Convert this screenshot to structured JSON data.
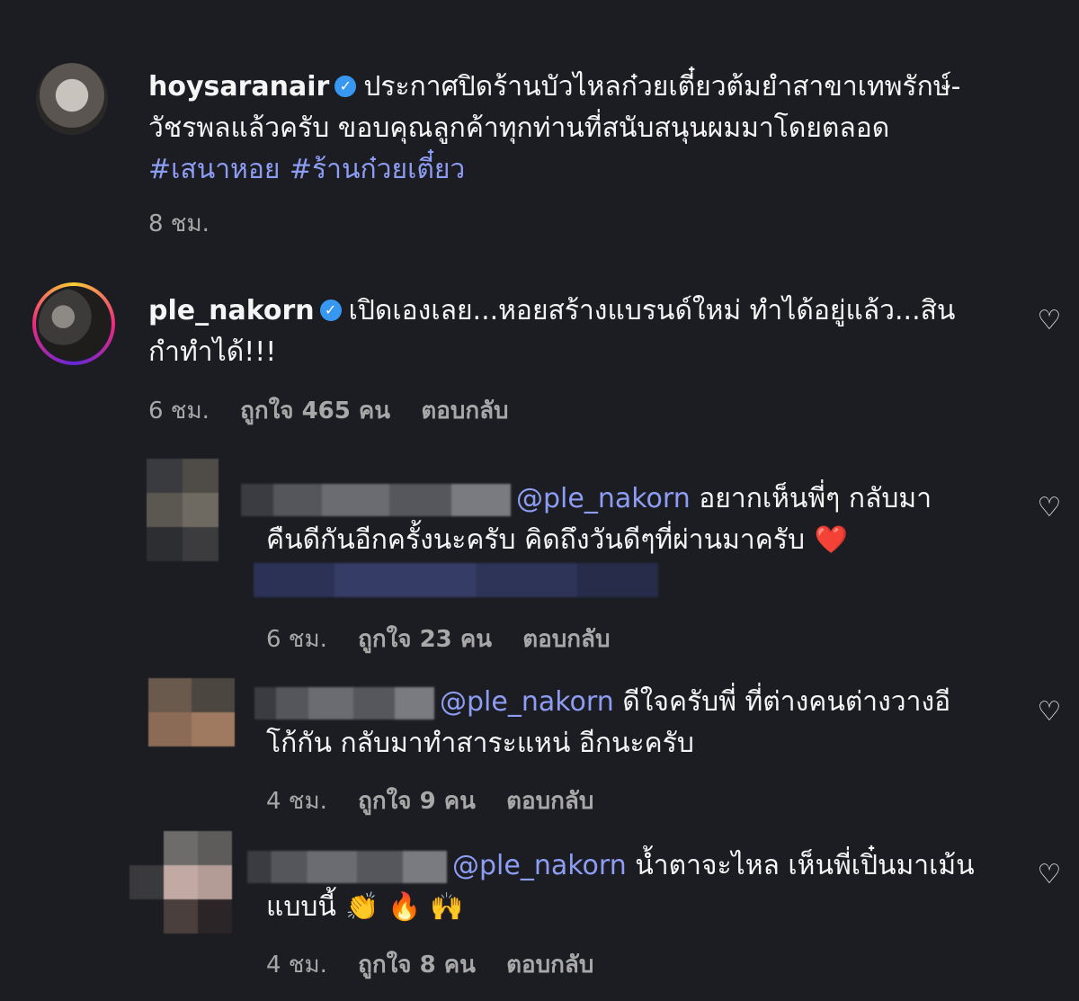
{
  "caption": {
    "username": "hoysaranair",
    "text_line1": "ประกาศปิดร้านบัวไหลก๋วยเตี๋ยวต้มยำสาขาเทพรักษ์-",
    "text_line2": "วัชรพลแล้วครับ ขอบคุณลูกค้าทุกท่านที่สนับสนุนผมมาโดยตลอด",
    "hashtag1": "#เสนาหอย",
    "hashtag2": "#ร้านก๋วยเตี๋ยว",
    "time": "8 ชม."
  },
  "comments": [
    {
      "username": "ple_nakorn",
      "text_line1": "เปิดเองเลย...หอยสร้างแบรนด์ใหม่ ทำได้อยู่แล้ว...สิน",
      "text_line2": "กำทำได้!!!",
      "time": "6 ชม.",
      "likes": "ถูกใจ 465 คน",
      "reply": "ตอบกลับ"
    },
    {
      "mention": "@ple_nakorn",
      "text_line1": " อยากเห็นพี่ๆ กลับมา",
      "text_line2": "คืนดีกันอีกครั้งนะครับ คิดถึงวันดีๆที่ผ่านมาครับ",
      "emoji": "❤️",
      "time": "6 ชม.",
      "likes": "ถูกใจ 23 คน",
      "reply": "ตอบกลับ"
    },
    {
      "mention": "@ple_nakorn",
      "text_line1": " ดีใจครับพี่ ที่ต่างคนต่างวางอี",
      "text_line2": "โก้กัน กลับมาทำสาระแหน่ อีกนะครับ",
      "time": "4 ชม.",
      "likes": "ถูกใจ 9 คน",
      "reply": "ตอบกลับ"
    },
    {
      "mention": "@ple_nakorn",
      "text_line1": " น้ำตาจะไหล เห็นพี่เปิ๋นมาเม้น",
      "text_line2": "แบบนี้",
      "emoji": "👏 🔥 🙌",
      "time": "4 ชม.",
      "likes": "ถูกใจ 8 คน",
      "reply": "ตอบกลับ"
    }
  ],
  "colors": {
    "background": "#1c1d22",
    "link": "#8e9df4",
    "meta": "#a8a8a8",
    "verified": "#3897f0"
  },
  "icons": [
    "verified-badge-icon",
    "heart-icon"
  ]
}
